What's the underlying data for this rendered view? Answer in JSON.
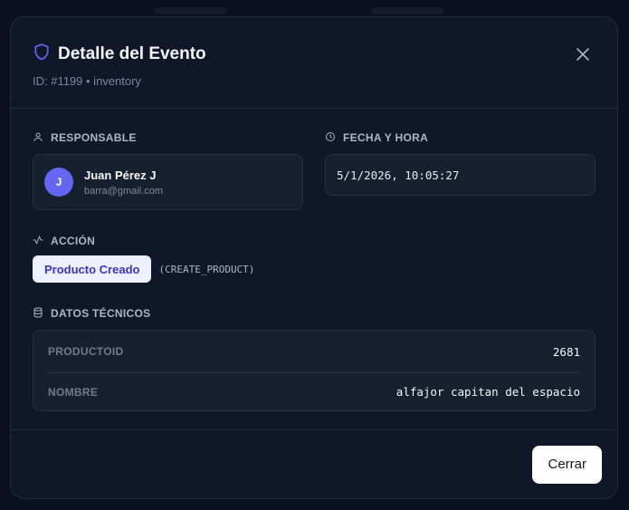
{
  "modal": {
    "title": "Detalle del Evento",
    "subtitle": "ID: #1199 • inventory",
    "accent_color": "#6366f1"
  },
  "responsable": {
    "label": "RESPONSABLE",
    "avatar_initial": "J",
    "name": "Juan Pérez J",
    "email": "barra@gmail.com"
  },
  "fecha": {
    "label": "FECHA Y HORA",
    "value": "5/1/2026, 10:05:27"
  },
  "accion": {
    "label": "ACCIÓN",
    "badge": "Producto Creado",
    "code": "(CREATE_PRODUCT)"
  },
  "datos_tecnicos": {
    "label": "DATOS TÉCNICOS",
    "rows": [
      {
        "key": "PRODUCTOID",
        "value": "2681"
      },
      {
        "key": "NOMBRE",
        "value": "alfajor capitan del espacio"
      }
    ]
  },
  "footer": {
    "close_label": "Cerrar"
  },
  "icons": {
    "title": "shield-icon",
    "close": "close-icon",
    "responsable": "user-icon",
    "fecha": "clock-icon",
    "accion": "activity-icon",
    "datos": "database-icon"
  }
}
